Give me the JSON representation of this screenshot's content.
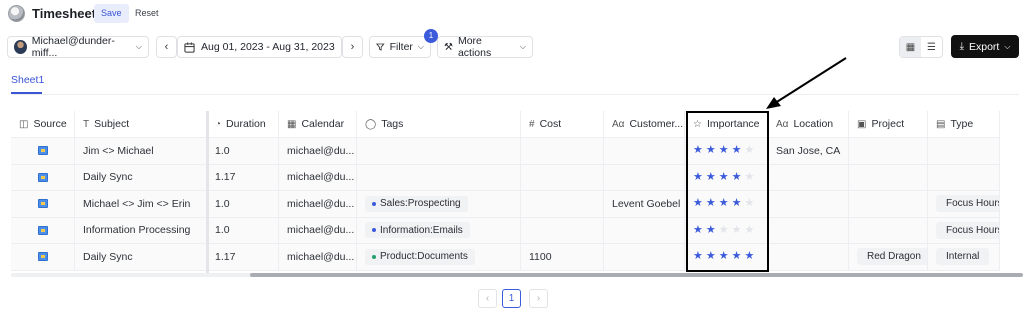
{
  "header": {
    "title": "Timesheet",
    "save_label": "Save",
    "reset_label": "Reset"
  },
  "toolbar": {
    "user": "Michael@dunder-miff...",
    "date_range": "Aug 01, 2023 - Aug 31, 2023",
    "filter_label": "Filter",
    "filter_count": "1",
    "more_actions_label": "More actions",
    "export_label": "Export"
  },
  "sheets": [
    {
      "label": "Sheet1",
      "active": true
    }
  ],
  "table": {
    "columns": [
      {
        "key": "source",
        "label": "Source",
        "icon": "database-icon"
      },
      {
        "key": "subject",
        "label": "Subject",
        "icon": "text-type-icon"
      },
      {
        "key": "duration",
        "label": "Duration",
        "icon": "timer-icon"
      },
      {
        "key": "calendar",
        "label": "Calendar",
        "icon": "calendar-icon"
      },
      {
        "key": "tags",
        "label": "Tags",
        "icon": "tag-icon"
      },
      {
        "key": "cost",
        "label": "Cost",
        "icon": "hash-icon"
      },
      {
        "key": "customer",
        "label": "Customer...",
        "icon": "text-field-icon"
      },
      {
        "key": "importance",
        "label": "Importance",
        "icon": "star-icon"
      },
      {
        "key": "location",
        "label": "Location",
        "icon": "text-field-icon"
      },
      {
        "key": "project",
        "label": "Project",
        "icon": "select-icon"
      },
      {
        "key": "type",
        "label": "Type",
        "icon": "document-icon"
      }
    ],
    "rows": [
      {
        "subject": "Jim <> Michael",
        "duration": "1.0",
        "calendar": "michael@du...",
        "tag": "",
        "tag_color": "",
        "cost": "",
        "customer": "",
        "importance": 4,
        "location": "San Jose, CA",
        "project": "",
        "type": ""
      },
      {
        "subject": "Daily Sync",
        "duration": "1.17",
        "calendar": "michael@du...",
        "tag": "",
        "tag_color": "",
        "cost": "",
        "customer": "",
        "importance": 4,
        "location": "",
        "project": "",
        "type": ""
      },
      {
        "subject": "Michael <> Jim <> Erin",
        "duration": "1.0",
        "calendar": "michael@du...",
        "tag": "Sales:Prospecting",
        "tag_color": "#3b5bdb",
        "cost": "",
        "customer": "Levent Goebel",
        "importance": 4,
        "location": "",
        "project": "",
        "type": "Focus Hours"
      },
      {
        "subject": "Information Processing",
        "duration": "1.0",
        "calendar": "michael@du...",
        "tag": "Information:Emails",
        "tag_color": "#3b5bdb",
        "cost": "",
        "customer": "",
        "importance": 2,
        "location": "",
        "project": "",
        "type": "Focus Hours"
      },
      {
        "subject": "Daily Sync",
        "duration": "1.17",
        "calendar": "michael@du...",
        "tag": "Product:Documents",
        "tag_color": "#22a06b",
        "cost": "1100",
        "customer": "",
        "importance": 5,
        "location": "",
        "project": "Red Dragon",
        "type": "Internal"
      }
    ],
    "importance_max": 5
  },
  "pagination": {
    "prev": "‹",
    "current": "1",
    "next": "›"
  },
  "colors": {
    "accent": "#3b5bdb",
    "star_on": "#3b5bdb",
    "star_off": "#e3e5ea",
    "export_bg": "#111111"
  }
}
